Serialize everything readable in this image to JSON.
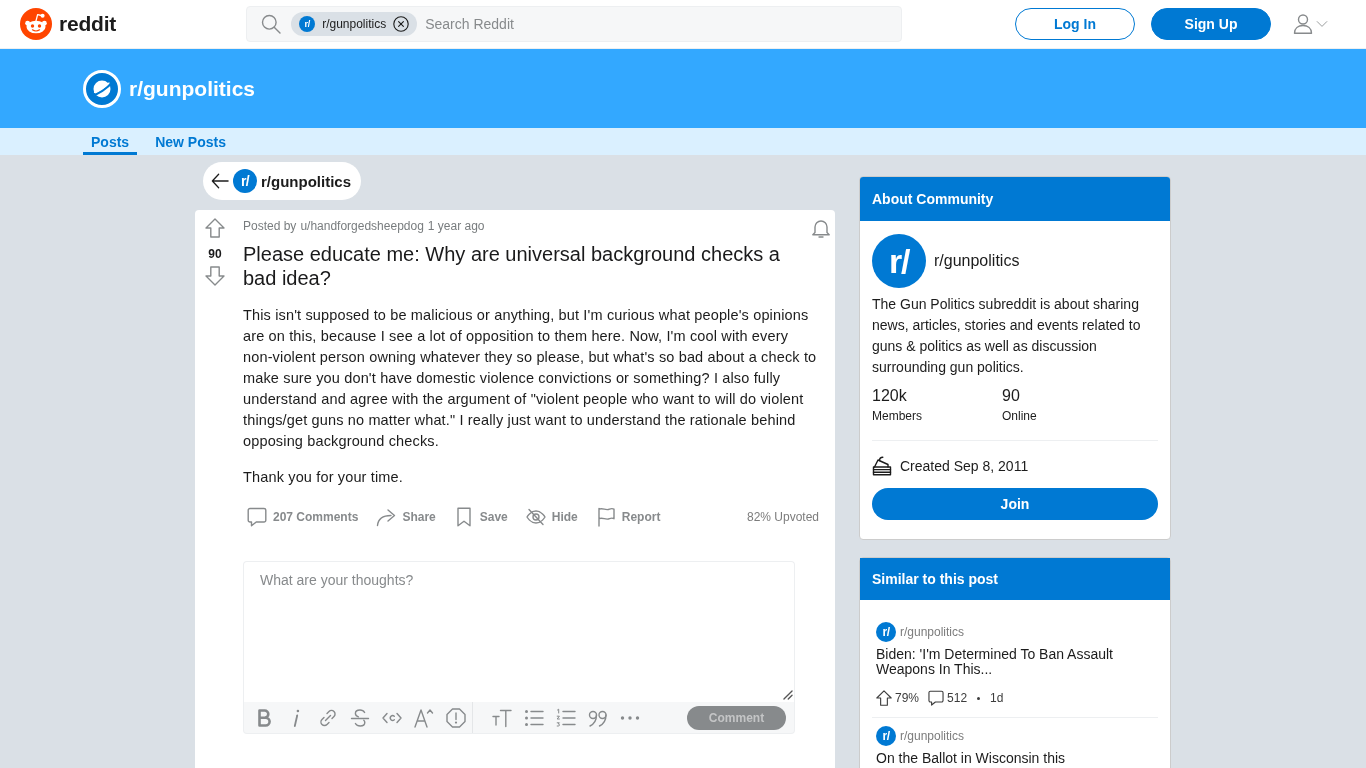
{
  "header": {
    "logo": {
      "text": "reddit"
    },
    "search": {
      "chip": {
        "icon_text": "r/",
        "label": "r/gunpolitics"
      },
      "placeholder": "Search Reddit"
    },
    "buttons": [
      {
        "label": "Log In",
        "kind": "outline"
      },
      {
        "label": "Sign Up",
        "kind": "filled"
      }
    ]
  },
  "banner": {
    "title": "r/gunpolitics"
  },
  "tabs": [
    {
      "label": "Posts",
      "selected": true
    },
    {
      "label": "New Posts",
      "selected": false
    }
  ],
  "back_link": {
    "icon_text": "r/",
    "label": "r/gunpolitics"
  },
  "post": {
    "score": "90",
    "posted_by": "Posted by",
    "author": "u/handforgedsheepdog",
    "age": "1 year ago",
    "title": "Please educate me: Why are universal background checks a bad idea?",
    "paragraphs": [
      "This isn't supposed to be malicious or anything, but I'm curious what people's opinions are on this, because I see a lot of opposition to them here. Now, I'm cool with every non-violent person owning whatever they so please, but what's so bad about a check to make sure you don't have domestic violence convictions or something? I also fully understand and agree with the argument of \"violent people who want to will do violent things/get guns no matter what.\" I really just want to understand the rationale behind opposing background checks.",
      "Thank you for your time."
    ],
    "actions": [
      {
        "kind": "comments",
        "label": "207 Comments"
      },
      {
        "kind": "share",
        "label": "Share"
      },
      {
        "kind": "save",
        "label": "Save"
      },
      {
        "kind": "hide",
        "label": "Hide"
      },
      {
        "kind": "report",
        "label": "Report"
      }
    ],
    "upvote_ratio": "82% Upvoted"
  },
  "comment_box": {
    "placeholder": "What are your thoughts?",
    "tool_groups": [
      {
        "tools": [
          {
            "kind": "bold"
          },
          {
            "kind": "italic"
          },
          {
            "kind": "link"
          },
          {
            "kind": "strikethrough"
          },
          {
            "kind": "code"
          },
          {
            "kind": "superscript"
          },
          {
            "kind": "spoiler"
          }
        ]
      },
      {
        "tools": [
          {
            "kind": "heading"
          },
          {
            "kind": "bulleted_list"
          },
          {
            "kind": "numbered_list"
          },
          {
            "kind": "quote"
          },
          {
            "kind": "more"
          }
        ]
      }
    ],
    "submit": {
      "label": "Comment",
      "disabled": true
    }
  },
  "sidebar": {
    "about": {
      "heading": "About Community",
      "icon_text": "r/",
      "name": "r/gunpolitics",
      "description": "The Gun Politics subreddit is about sharing news, articles, stories and events related to guns & politics as well as discussion surrounding gun politics.",
      "stats": [
        {
          "value": "120k",
          "label": "Members"
        },
        {
          "value": "90",
          "label": "Online"
        }
      ],
      "created": "Created Sep 8, 2011",
      "join_button": "Join"
    },
    "similar": {
      "heading": "Similar to this post",
      "posts": [
        {
          "icon_text": "r/",
          "community": "r/gunpolitics",
          "title": "Biden: 'I'm Determined To Ban Assault Weapons In This...",
          "upvoted": "79%",
          "comments": "512",
          "age": "1d"
        },
        {
          "icon_text": "r/",
          "community": "r/gunpolitics",
          "title": "On the Ballot in Wisconsin this"
        }
      ]
    }
  }
}
